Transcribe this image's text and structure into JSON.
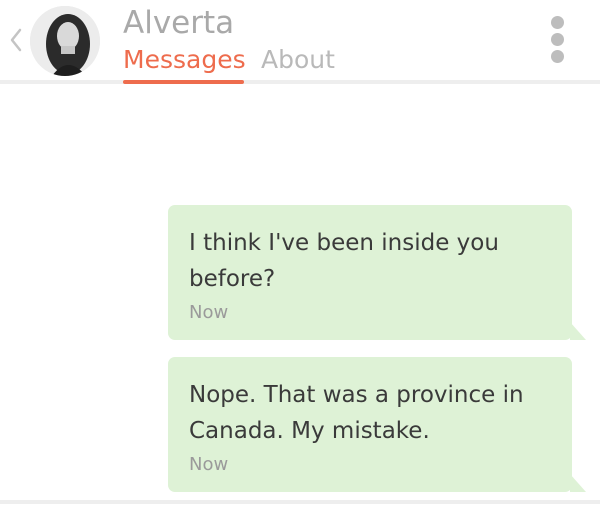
{
  "header": {
    "contact_name": "Alverta",
    "tabs": [
      {
        "label": "Messages",
        "active": true
      },
      {
        "label": "About",
        "active": false
      }
    ],
    "back_icon": "chevron-left-icon",
    "menu_icon": "vertical-dots-icon"
  },
  "messages": [
    {
      "text": "I think I've been inside you before?",
      "time": "Now"
    },
    {
      "text": "Nope. That was a province in Canada. My mistake.",
      "time": "Now"
    }
  ],
  "colors": {
    "accent": "#ee6c4d",
    "bubble": "#def2d6"
  }
}
